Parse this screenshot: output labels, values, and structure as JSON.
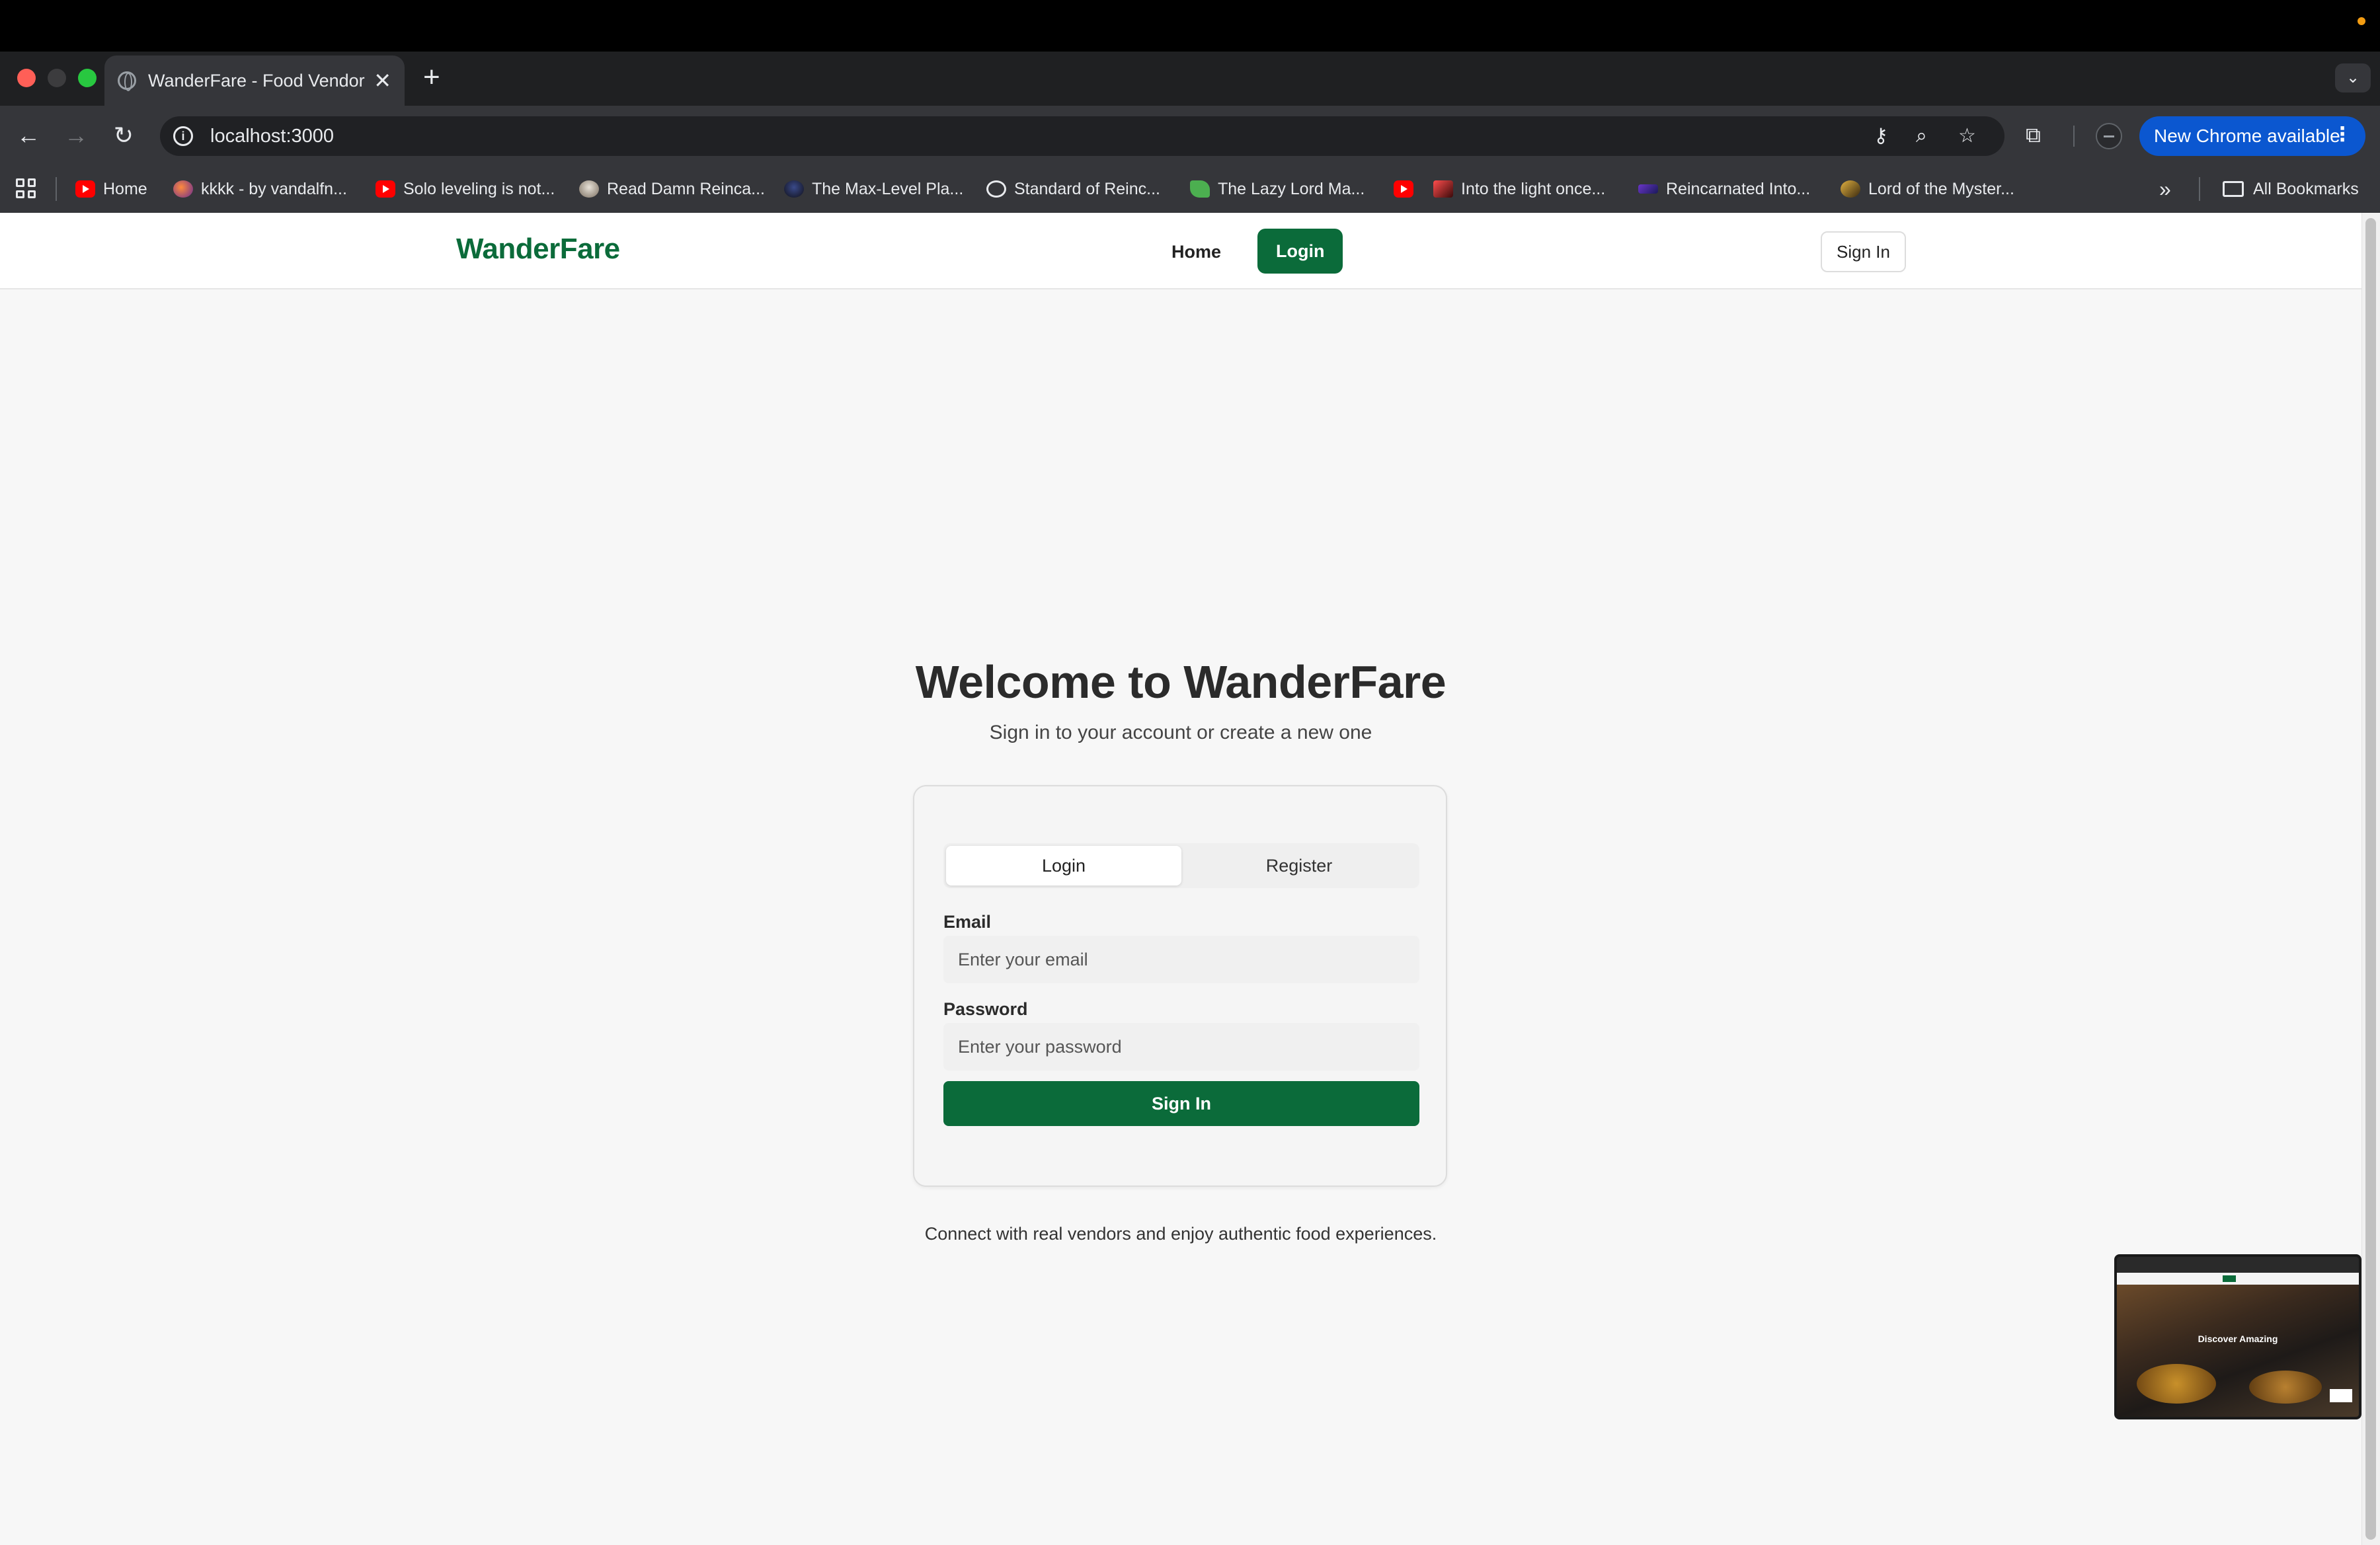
{
  "browser": {
    "tab_title": "WanderFare - Food Vendor M",
    "tab_close": "✕",
    "new_tab": "+",
    "url": "localhost:3000",
    "update_label": "New Chrome available",
    "update_menu": "⋮",
    "tab_dropdown": "⌄"
  },
  "bookmarks": [
    {
      "label": "Home",
      "icon": "youtube-icon"
    },
    {
      "label": "kkkk - by vandalfn...",
      "icon": "orb-icon"
    },
    {
      "label": "Solo leveling is not...",
      "icon": "youtube-icon"
    },
    {
      "label": "Read Damn Reinca...",
      "icon": "skull-icon"
    },
    {
      "label": "The Max-Level Pla...",
      "icon": "dark-avatar-icon"
    },
    {
      "label": "Standard of Reinc...",
      "icon": "globe-icon"
    },
    {
      "label": "The Lazy Lord Ma...",
      "icon": "leaf-icon"
    },
    {
      "label": "",
      "icon": "youtube-icon"
    },
    {
      "label": "Into the light once...",
      "icon": "red-avatar-icon"
    },
    {
      "label": "Reincarnated Into...",
      "icon": "purple-icon"
    },
    {
      "label": "Lord of the Myster...",
      "icon": "gold-icon"
    }
  ],
  "bookmarks_more": "»",
  "all_bookmarks": "All Bookmarks",
  "site": {
    "brand": "WanderFare",
    "nav_home": "Home",
    "nav_login": "Login",
    "header_signin": "Sign In",
    "brand_color": "#0b6b3a"
  },
  "hero": {
    "title": "Welcome to WanderFare",
    "subtitle": "Sign in to your account or create a new one"
  },
  "auth": {
    "tab_login": "Login",
    "tab_register": "Register",
    "email_label": "Email",
    "email_placeholder": "Enter your email",
    "password_label": "Password",
    "password_placeholder": "Enter your password",
    "submit": "Sign In"
  },
  "footer_note": "Connect with real vendors and enjoy authentic food experiences.",
  "pip": {
    "title": "Discover Amazing"
  }
}
